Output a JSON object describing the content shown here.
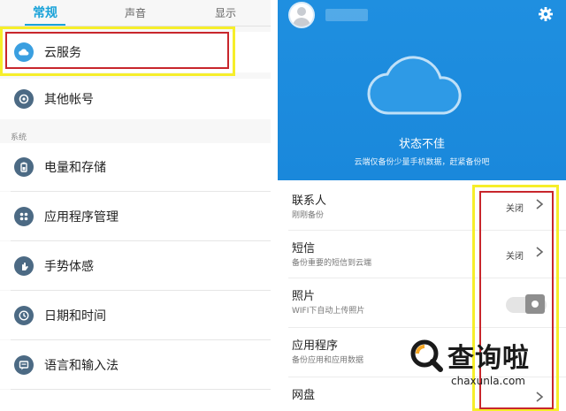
{
  "left": {
    "tabs": [
      {
        "label": "常规",
        "active": true
      },
      {
        "label": "声音",
        "active": false
      },
      {
        "label": "显示",
        "active": false
      }
    ],
    "section_label": "系统",
    "items": [
      {
        "label": "云服务",
        "icon": "cloud-icon"
      },
      {
        "label": "其他帐号",
        "icon": "account-sync-icon"
      },
      {
        "label": "电量和存储",
        "icon": "battery-icon"
      },
      {
        "label": "应用程序管理",
        "icon": "apps-icon"
      },
      {
        "label": "手势体感",
        "icon": "gesture-icon"
      },
      {
        "label": "日期和时间",
        "icon": "clock-icon"
      },
      {
        "label": "语言和输入法",
        "icon": "language-icon"
      }
    ]
  },
  "right": {
    "status_title": "状态不佳",
    "status_sub": "云端仅备份少量手机数据，赶紧备份吧",
    "items": [
      {
        "title": "联系人",
        "sub": "刚刚备份",
        "state": "关闭",
        "control": "chevron"
      },
      {
        "title": "短信",
        "sub": "备份重要的短信到云端",
        "state": "关闭",
        "control": "chevron"
      },
      {
        "title": "照片",
        "sub": "WIFI下自动上传照片",
        "state": "",
        "control": "toggle",
        "toggle_on": false
      },
      {
        "title": "应用程序",
        "sub": "备份应用和应用数据",
        "state": "",
        "control": "none"
      },
      {
        "title": "网盘",
        "sub": "",
        "state": "",
        "control": "chevron"
      }
    ]
  },
  "watermark": {
    "brand": "查询啦",
    "url": "chaxunla.com"
  },
  "colors": {
    "accent": "#1aa3d9",
    "hero_blue": "#1f8fe0",
    "highlight_yellow": "#f6ee2a",
    "highlight_red": "#c8262c",
    "icon_slate": "#4c6a84"
  }
}
